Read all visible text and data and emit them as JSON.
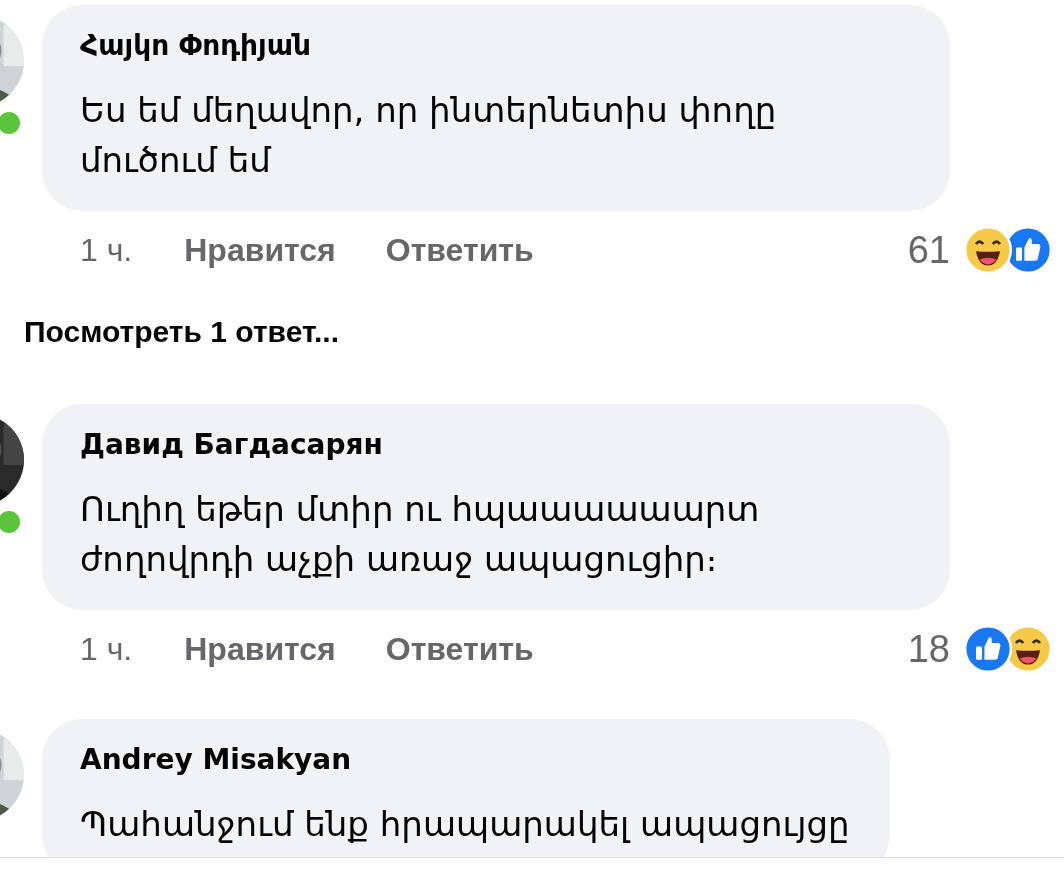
{
  "comments": [
    {
      "author": "Հայկո Փոդիյան",
      "text": "Ես եմ մեղավոր, որ ինտերնետիս փողը մուծում եմ",
      "online": true,
      "time": "1 ч.",
      "like_label": "Нравится",
      "reply_label": "Ответить",
      "reaction_count": "61",
      "reactions": [
        {
          "kind": "haha"
        },
        {
          "kind": "like"
        }
      ],
      "view_replies": "Посмотреть 1 ответ..."
    },
    {
      "author": "Давид Багдасарян",
      "text": "Ուղիղ եթեր մտիր ու հպաաաաաարտ ժողովրդի աչքի առաջ ապացուցիր։",
      "online": true,
      "time": "1 ч.",
      "like_label": "Нравится",
      "reply_label": "Ответить",
      "reaction_count": "18",
      "reactions": [
        {
          "kind": "like"
        },
        {
          "kind": "haha"
        }
      ]
    },
    {
      "author": "Andrey Misakyan",
      "text": "Պահանջում ենք հրապարակել ապացույցը",
      "online": false
    }
  ]
}
